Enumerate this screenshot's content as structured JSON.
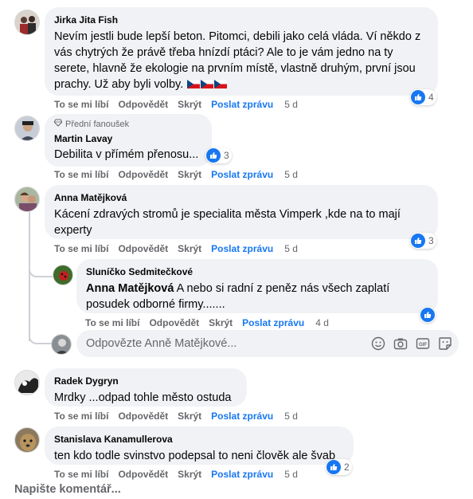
{
  "actions": {
    "like": "To se mi líbí",
    "reply": "Odpovědět",
    "hide": "Skrýt",
    "send_message": "Poslat zprávu"
  },
  "comments": [
    {
      "author": "Jirka Jita Fish",
      "text": "Nevím jestli bude lepší beton. Pitomci, debili jako celá vláda. Ví někdo z vás chytrých že právě třeba hnízdí ptáci? Ale to je vám jedno na ty serete, hlavně že ekologie na prvním místě, vlastně druhým, první jsou prachy. Už aby byli volby.",
      "time": "5 d",
      "reactions": "4"
    },
    {
      "badge": "Přední fanoušek",
      "author": "Martin Lavay",
      "text": "Debilita v přímém přenosu...",
      "time": "5 d",
      "reactions": "3"
    },
    {
      "author": "Anna Matějková",
      "text": "Kácení zdravých stromů je specialita města Vimperk ,kde na to mají experty",
      "time": "5 d",
      "reactions": "3",
      "reply": {
        "author": "Sluníčko Sedmitečkové",
        "mention": "Anna Matějková",
        "text": " A nebo si radní z peněz nás všech zaplatí posudek odborné firmy.......",
        "time": "4 d"
      },
      "reply_placeholder": "Odpovězte Anně Matějkové..."
    },
    {
      "author": "Radek Dygryn",
      "text": "Mrdky ...odpad tohle město ostuda",
      "time": "5 d"
    },
    {
      "author": "Stanislava Kanamullerova",
      "text": "ten kdo todle svinstvo podepsal to neni člověk ale švab",
      "time": "5 d",
      "reactions": "2"
    }
  ],
  "footer": {
    "write_comment": "Napište komentář..."
  },
  "icons": {
    "like": "thumbs-up-icon",
    "flag": "czech-flag-icon",
    "emoji": "emoji-icon",
    "camera": "camera-icon",
    "gif": "gif-icon",
    "sticker": "sticker-icon",
    "badge": "diamond-icon"
  },
  "colors": {
    "like_blue": "#1877f2",
    "bubble": "#f0f2f5",
    "meta_text": "#65676b"
  }
}
